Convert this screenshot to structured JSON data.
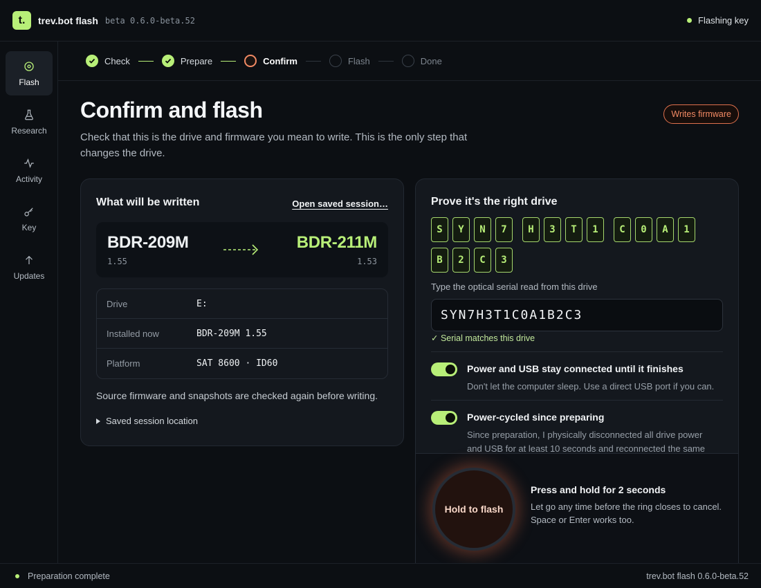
{
  "app": {
    "logo": "t.",
    "name": "trev.bot flash",
    "version": "beta 0.6.0-beta.52",
    "status": "Flashing key",
    "accent": "#b8ef78",
    "warning": "#f28a64"
  },
  "sidebar": {
    "items": [
      {
        "label": "Flash",
        "icon": "target-icon",
        "active": true
      },
      {
        "label": "Research",
        "icon": "flask-icon"
      },
      {
        "label": "Activity",
        "icon": "pulse-icon"
      },
      {
        "label": "Key",
        "icon": "key-icon"
      },
      {
        "label": "Updates",
        "icon": "arrow-up-icon"
      }
    ]
  },
  "stepper": {
    "steps": [
      {
        "label": "Check",
        "state": "done"
      },
      {
        "label": "Prepare",
        "state": "done"
      },
      {
        "label": "Confirm",
        "state": "current"
      },
      {
        "label": "Flash",
        "state": "pending"
      },
      {
        "label": "Done",
        "state": "pending"
      }
    ]
  },
  "page": {
    "title": "Confirm and flash",
    "subtitle": "Check that this is the drive and firmware you mean to write. This is the only step that changes the drive.",
    "badge": "Writes firmware"
  },
  "written": {
    "heading": "What will be written",
    "open_session": "Open saved session…",
    "from_model": "BDR-209M",
    "from_version": "1.55",
    "to_model": "BDR-211M",
    "to_version": "1.53",
    "rows": [
      {
        "key": "Drive",
        "value": "E:"
      },
      {
        "key": "Installed now",
        "value": "BDR-209M 1.55"
      },
      {
        "key": "Platform",
        "value": "SAT 8600 · ID60"
      }
    ],
    "note": "Source firmware and snapshots are checked again before writing.",
    "session_location": "Saved session location"
  },
  "prove": {
    "heading": "Prove it's the right drive",
    "serial_groups": [
      [
        "S",
        "Y",
        "N",
        "7"
      ],
      [
        "H",
        "3",
        "T",
        "1"
      ],
      [
        "C",
        "0",
        "A",
        "1"
      ],
      [
        "B",
        "2",
        "C",
        "3"
      ]
    ],
    "serial_label": "Type the optical serial read from this drive",
    "serial_value": "SYN7H3T1C0A1B2C3",
    "serial_ok": "✓ Serial matches this drive",
    "toggles": [
      {
        "title": "Power and USB stay connected until it finishes",
        "desc": "Don't let the computer sleep. Use a direct USB port if you can.",
        "on": true
      },
      {
        "title": "Power-cycled since preparing",
        "desc": "Since preparation, I physically disconnected all drive power and USB for at least 10 seconds and reconnected the same",
        "on": true
      }
    ],
    "hold_button": "Hold to flash",
    "hold_title": "Press and hold for 2 seconds",
    "hold_desc": "Let go any time before the ring closes to cancel. Space or Enter works too."
  },
  "status": {
    "left": "Preparation complete",
    "right": "trev.bot flash 0.6.0-beta.52"
  }
}
